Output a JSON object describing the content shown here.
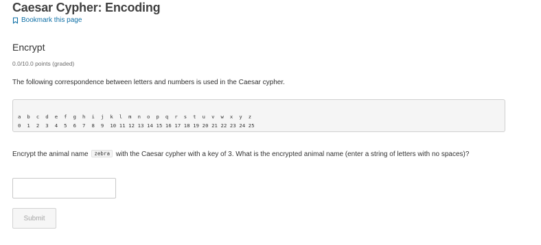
{
  "header": {
    "title": "Caesar Cypher: Encoding",
    "bookmark_label": "Bookmark this page",
    "bookmark_icon": "bookmark-icon"
  },
  "problem": {
    "heading": "Encrypt",
    "points": "0.0/10.0 points (graded)",
    "intro": "The following correspondence between letters and numbers is used in the Caesar cypher.",
    "code_letters": "a  b  c  d  e  f  g  h  i  j  k  l  m  n  o  p  q  r  s  t  u  v  w  x  y  z",
    "code_numbers": "0  1  2  3  4  5  6  7  8  9  10 11 12 13 14 15 16 17 18 19 20 21 22 23 24 25",
    "question_before": "Encrypt the animal name ",
    "question_code": "zebra",
    "question_after": " with the Caesar cypher with a key of 3. What is the encrypted animal name (enter a string of letters with no spaces)?",
    "answer_value": "",
    "submit_label": "Submit"
  },
  "colors": {
    "link": "#0e6fa6",
    "text": "#313131",
    "code_background": "#f5f5f5",
    "submit_disabled_text": "#a6a6a6"
  }
}
